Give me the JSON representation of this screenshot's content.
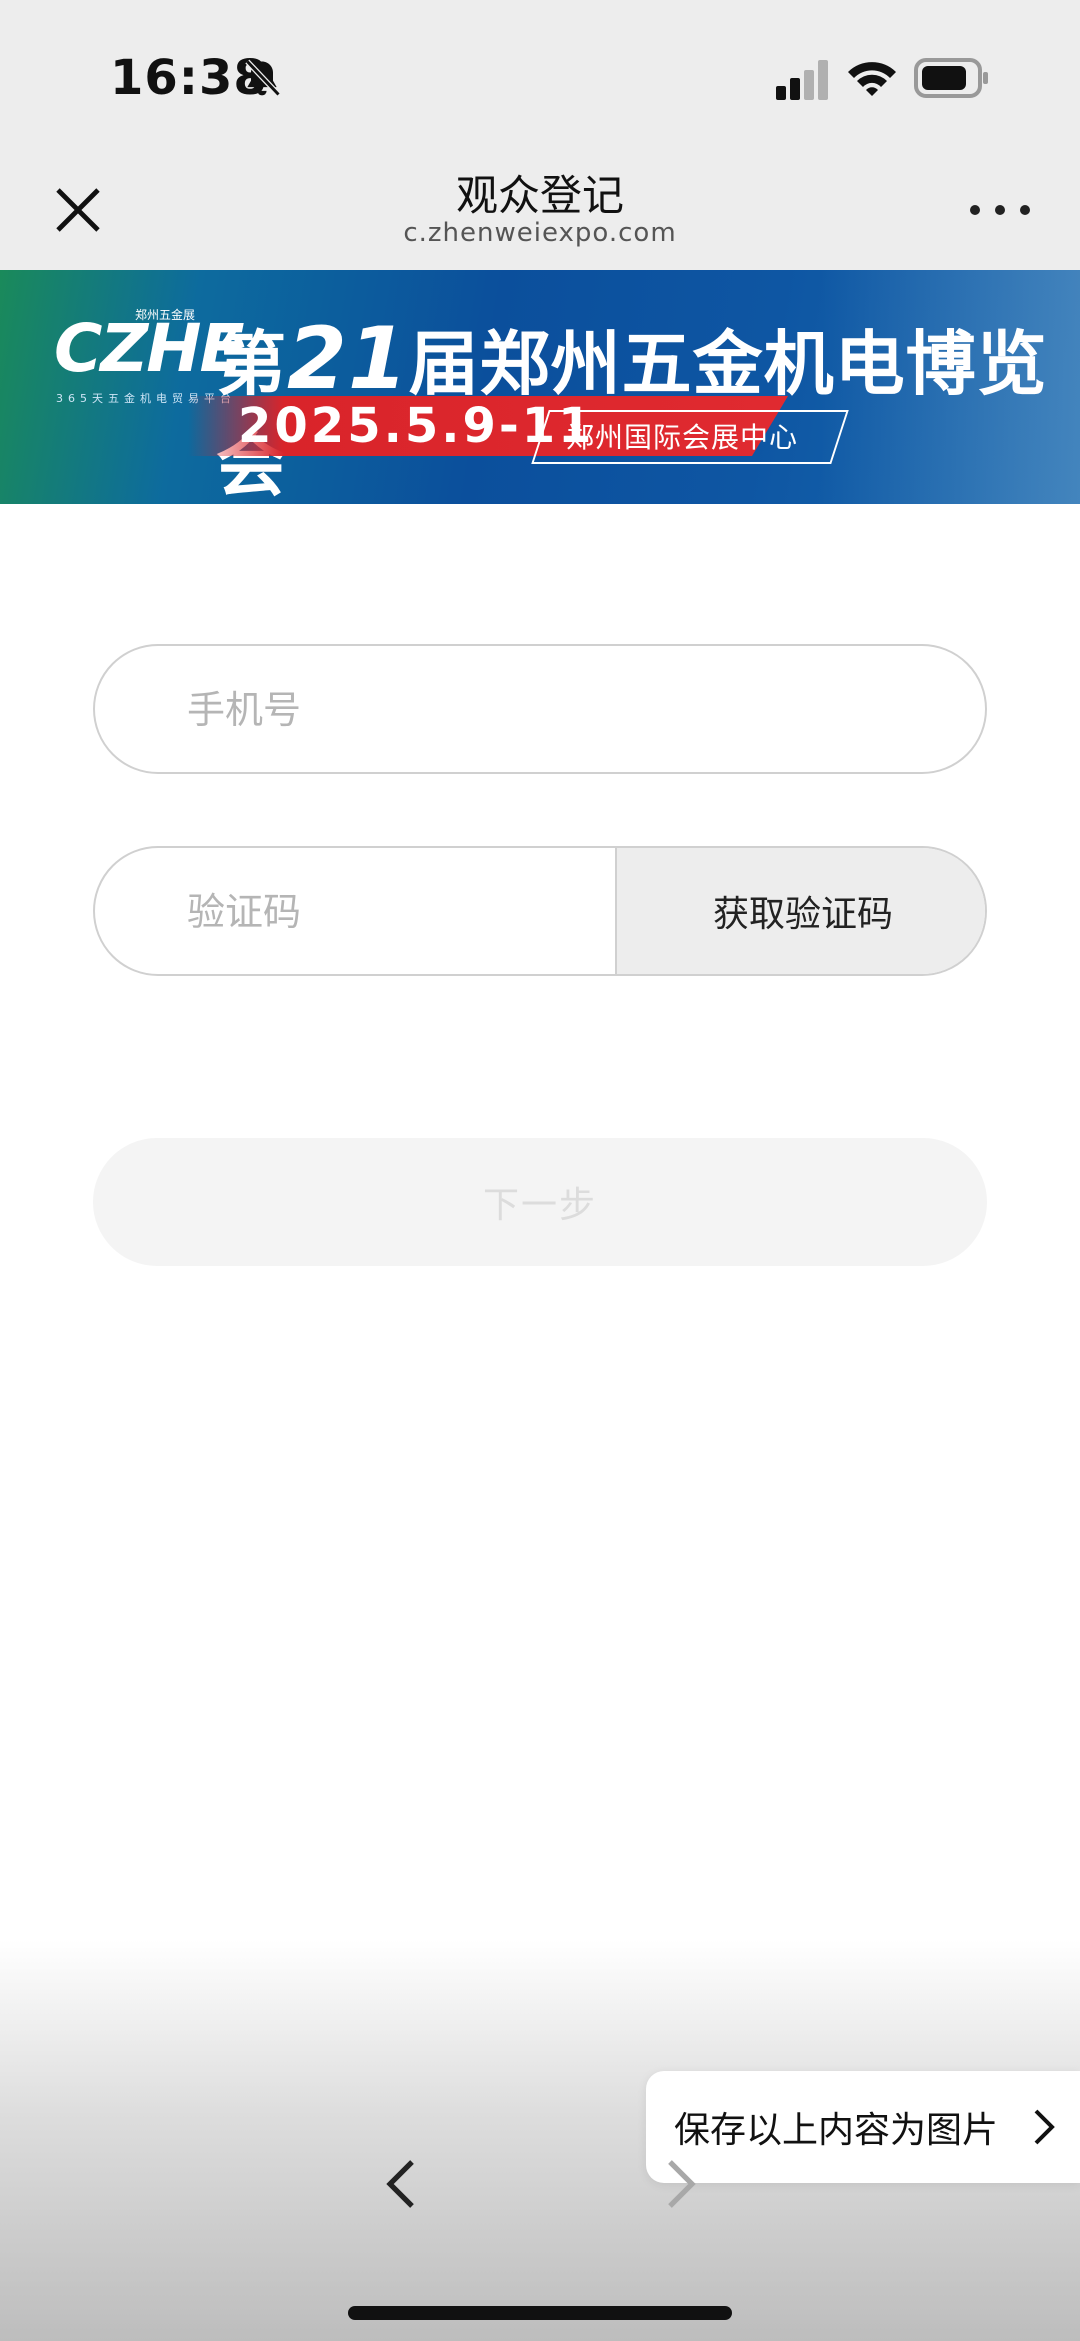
{
  "status_bar": {
    "time": "16:38",
    "icons": [
      "bell-slash-icon",
      "cellular-signal-icon",
      "wifi-icon",
      "battery-icon"
    ]
  },
  "nav": {
    "title": "观众登记",
    "url": "c.zhenweiexpo.com",
    "icons": [
      "close-icon",
      "more-icon"
    ]
  },
  "banner": {
    "logo_text": "CZHE",
    "logo_top": "郑州五金展",
    "logo_sub": "365天五金机电贸易平台",
    "title_pre": "第",
    "title_num": "21",
    "title_post": "届郑州五金机电博览会",
    "date": "2025.5.9-11",
    "venue": "郑州国际会展中心"
  },
  "form": {
    "phone_placeholder": "手机号",
    "code_placeholder": "验证码",
    "get_code_label": "获取验证码",
    "next_label": "下一步"
  },
  "bottom": {
    "save_label": "保存以上内容为图片",
    "icons": [
      "chevron-right-icon",
      "back-arrow-icon",
      "forward-arrow-icon"
    ]
  },
  "colors": {
    "background": "#ededed",
    "banner_blue": "#0b4f9c",
    "banner_red": "#d9242a",
    "button_disabled": "#f4f4f4"
  }
}
